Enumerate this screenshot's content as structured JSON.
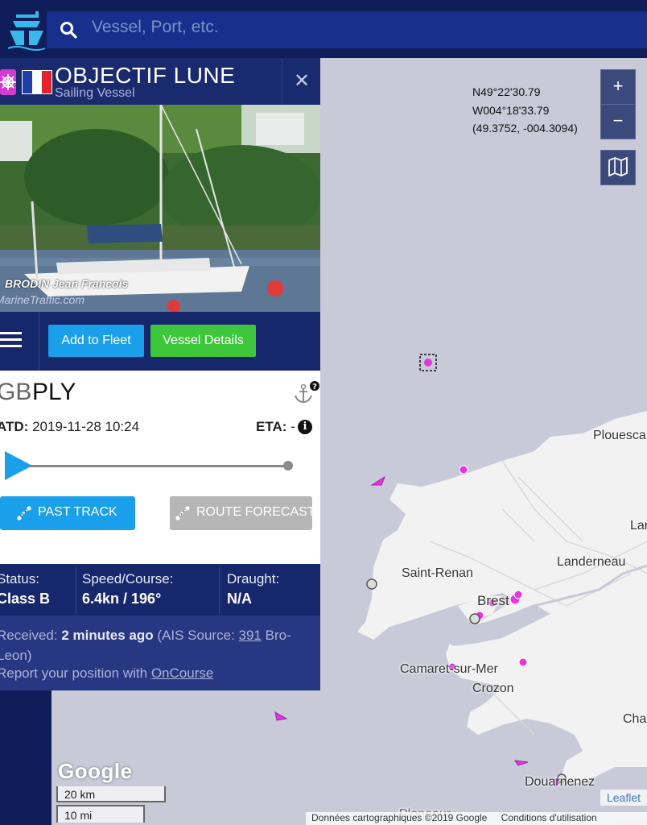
{
  "search": {
    "placeholder": "Vessel, Port, etc."
  },
  "vessel": {
    "name": "OBJECTIF LUNE",
    "type": "Sailing Vessel",
    "photo_caption": "BRODIN Jean Francois",
    "photo_watermark": "MarineTraffic.com"
  },
  "actions": {
    "add_to_fleet": "Add to Fleet",
    "vessel_details": "Vessel Details"
  },
  "voyage": {
    "departure_code": "GB",
    "destination_code": "PLY",
    "atd_label": "ATD:",
    "atd_value": "2019-11-28 10:24",
    "eta_label": "ETA:",
    "eta_value": "-",
    "progress": 0.0,
    "past_track": "PAST TRACK",
    "route_forecast": "ROUTE FORECAST"
  },
  "stats": {
    "status_label": "Status:",
    "status_value": "Class B",
    "speed_label": "Speed/Course:",
    "speed_value": "6.4kn / 196°",
    "draught_label": "Draught:",
    "draught_value": "N/A"
  },
  "received": {
    "label": "Received:",
    "value": "2 minutes ago",
    "source_prefix": "(AIS Source:",
    "source_id": "391",
    "source_name": "Bro-Leon)",
    "report_prefix": "Report your position with",
    "report_link": "OnCourse"
  },
  "map": {
    "coords_lat": "N49°22'30.79",
    "coords_lon": "W004°18'33.79",
    "coords_decimal": "(49.3752, -004.3094)",
    "zoom_in": "+",
    "zoom_out": "−",
    "places": {
      "plouescat": "Plouesca",
      "lan": "Lar",
      "landerneau": "Landerneau",
      "saint_renan": "Saint-Renan",
      "brest": "Brest",
      "camaret": "Camaret-sur-Mer",
      "crozon": "Crozon",
      "cha": "Cha",
      "douarnenez": "Douarnenez",
      "ploneour": "Ploneour"
    },
    "google": "Google",
    "scale_km": "20 km",
    "scale_mi": "10 mi",
    "attribution": "Données cartographiques ©2019 Google",
    "terms": "Conditions d'utilisation",
    "leaflet": "Leaflet"
  },
  "colors": {
    "header_bg": "#0f1d58",
    "panel_bg": "#17276c",
    "accent_blue": "#1aa0ea",
    "accent_green": "#3ec73a",
    "vessel_magenta": "#e536e0",
    "sea": "#c8cad8",
    "land": "#f2f2f2"
  }
}
